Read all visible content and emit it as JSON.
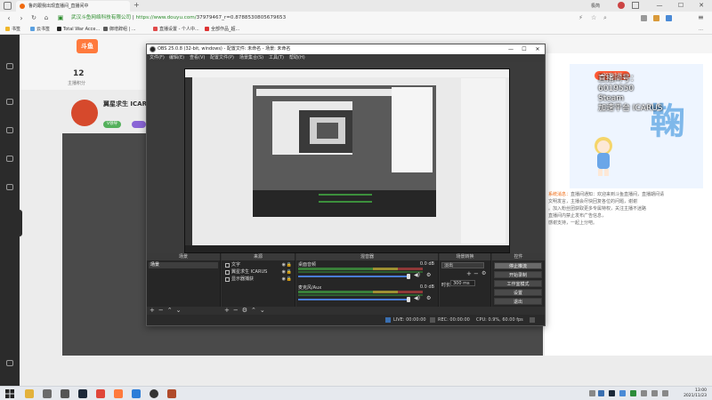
{
  "browser": {
    "tab_title": "鲁的跟我出现直播间_直播间中",
    "url_cert": "武汉斗鱼网络科技有限公司",
    "url_host": "https://www.douyu.com/",
    "url_path": "37979467_r=0.8788530805679653",
    "user_label": "极简",
    "window_controls": [
      "—",
      "☐",
      "✕"
    ],
    "bookmarks": [
      "书签",
      "云书签",
      "Total War Acce...",
      "御增辞组 | ...",
      "直播设置 - 个人中...",
      "全部作品_超...",
      "…"
    ]
  },
  "douyu": {
    "logo": "斗鱼",
    "stat_number": "12",
    "stat_label": "主播积分",
    "anchor_name": "翼星求生 ICARU",
    "tag_label": "V领导",
    "chat_badge": "PC客户端",
    "info_lines": [
      "直播间号：",
      "6019550",
      "Steam",
      "加速平台 ICARUS"
    ],
    "big_number": "鞠",
    "chat_lines": [
      "直播间通知：欢迎来到斗鱼直播间，直播期间请",
      "文明发言，主播会尽快回复各位的问题，谢谢",
      "。加入粉丝团获取更多专属特权，关注主播不迷路",
      "直播间内禁止发布广告信息，",
      "感谢支持，一起上分吧。"
    ],
    "chat_highlight": "系统消息："
  },
  "obs": {
    "title": "OBS 25.0.8 (32-bit, windows) - 配置文件: 未命名 - 场景: 未命名",
    "menu": [
      "文件(F)",
      "编辑(E)",
      "查看(V)",
      "配置文件(P)",
      "场景集合(S)",
      "工具(T)",
      "帮助(H)"
    ],
    "docks": {
      "scenes": {
        "header": "场景",
        "items": [
          "场景"
        ]
      },
      "sources": {
        "header": "来源",
        "items": [
          {
            "name": "文字",
            "eye": "◉",
            "lock": "🔒"
          },
          {
            "name": "翼星求生 ICARUS",
            "eye": "◉",
            "lock": "🔒"
          },
          {
            "name": "显示器捕获",
            "eye": "◉",
            "lock": "🔒"
          }
        ]
      },
      "mixer": {
        "header": "混音器",
        "channels": [
          {
            "name": "桌面音频",
            "db": "0.0 dB"
          },
          {
            "name": "麦克风/Aux",
            "db": "0.0 dB"
          }
        ]
      },
      "transitions": {
        "header": "场景转换",
        "selected": "淡出",
        "duration_label": "时长",
        "duration_value": "300 ms"
      },
      "controls": {
        "header": "控件",
        "buttons": [
          "停止推流",
          "开始录制",
          "工作室模式",
          "设置",
          "退出"
        ]
      }
    },
    "status": {
      "live": "LIVE: 00:00:00",
      "rec": "REC: 00:00:00",
      "cpu": "CPU: 0.9%, 60.00 fps"
    }
  },
  "taskbar": {
    "time": "13:00",
    "date": "2021/11/23"
  },
  "colors": {
    "douyu_orange": "#ff7a3d",
    "obs_bg": "#2a2a2a",
    "url_green": "#2a8c2a"
  }
}
